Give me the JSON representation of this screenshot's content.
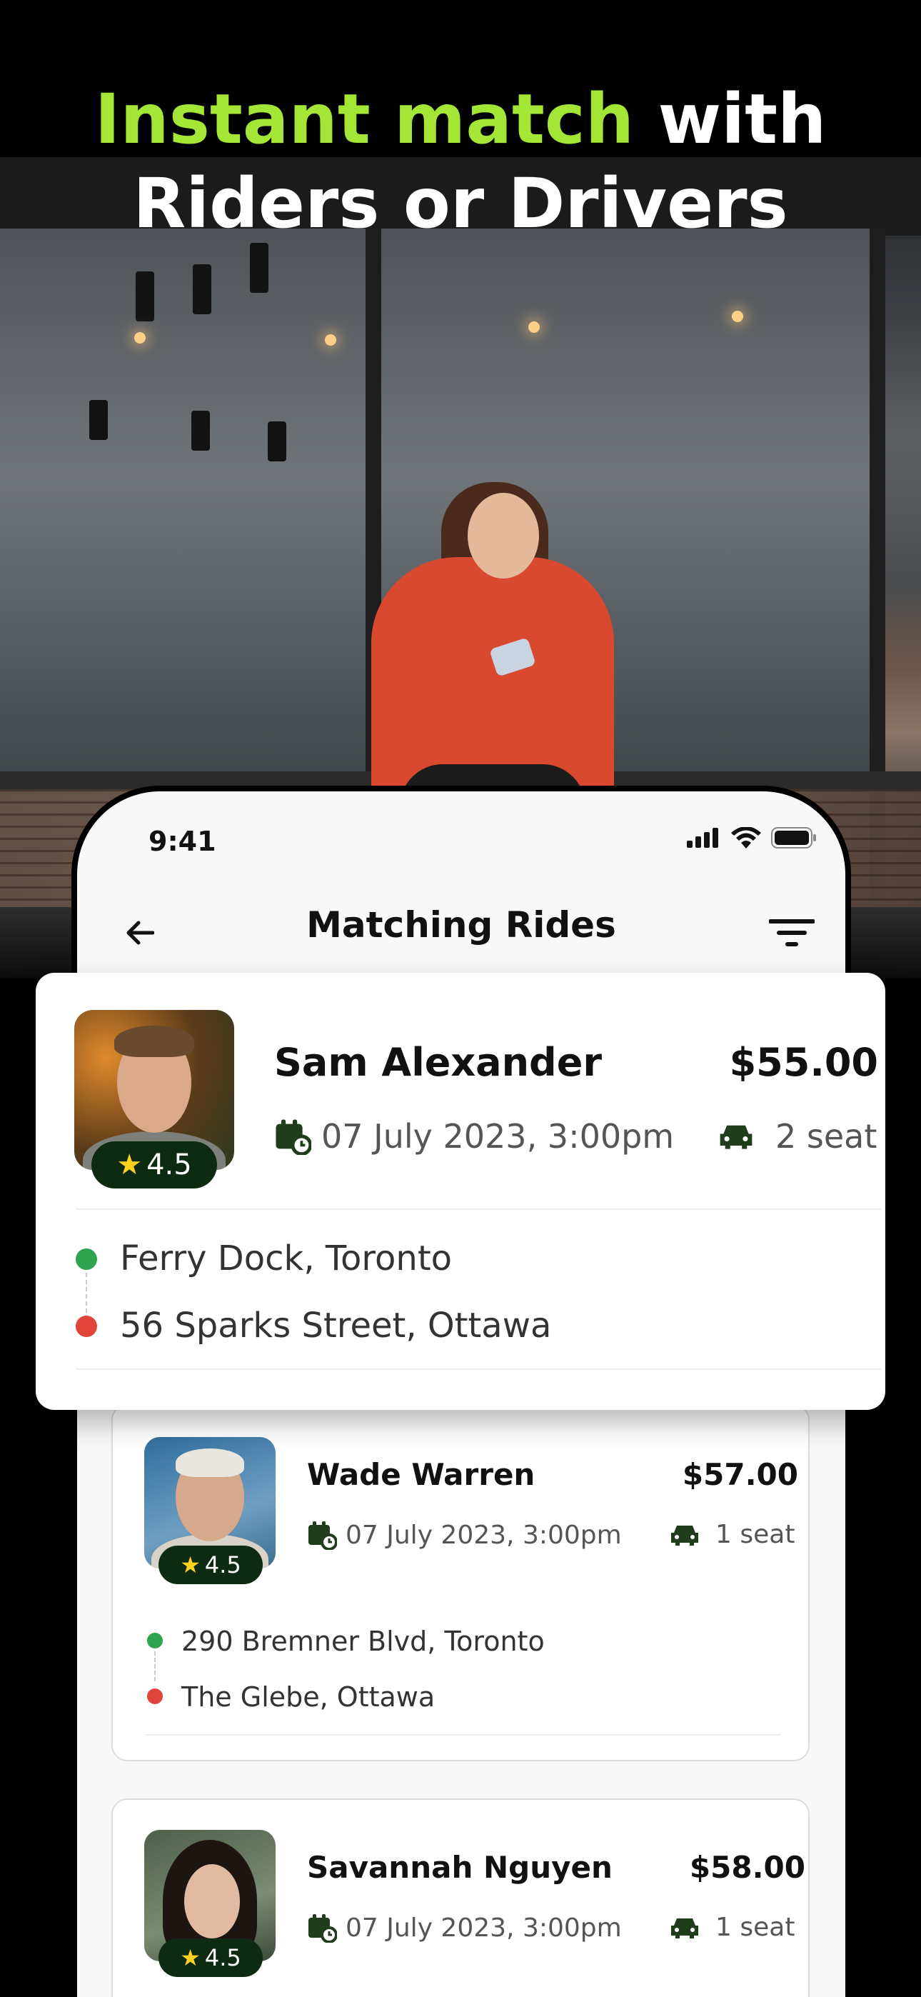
{
  "headline": {
    "accent": "Instant match",
    "rest_line1": " with",
    "line2": "Riders or Drivers"
  },
  "status_bar": {
    "time": "9:41"
  },
  "nav": {
    "title": "Matching Rides"
  },
  "rides": [
    {
      "name": "Sam Alexander",
      "price": "$55.00",
      "rating": "4.5",
      "date": "07 July 2023, 3:00pm",
      "seats": "2 seat",
      "pickup": "Ferry Dock, Toronto",
      "dropoff": "56 Sparks Street, Ottawa"
    },
    {
      "name": "Wade Warren",
      "price": "$57.00",
      "rating": "4.5",
      "date": "07 July 2023, 3:00pm",
      "seats": "1 seat",
      "pickup": "290 Bremner Blvd, Toronto",
      "dropoff": "The Glebe, Ottawa"
    },
    {
      "name": "Savannah Nguyen",
      "price": "$58.00",
      "rating": "4.5",
      "date": "07 July 2023, 3:00pm",
      "seats": "1 seat"
    }
  ],
  "colors": {
    "accent": "#a3e635",
    "rating_badge": "#0d2b10",
    "pickup_dot": "#2ea44f",
    "dropoff_dot": "#e0443a",
    "icon_green": "#1f3d1a"
  },
  "icons": {
    "back": "arrow-left-icon",
    "filter": "filter-icon",
    "date": "calendar-clock-icon",
    "seat": "car-icon",
    "rating": "star-icon"
  }
}
